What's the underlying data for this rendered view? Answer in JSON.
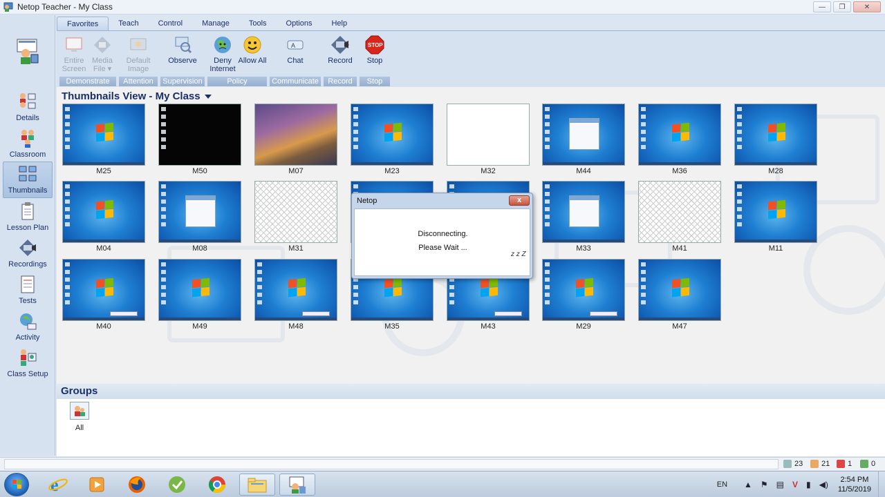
{
  "window": {
    "title": "Netop Teacher - My Class",
    "min": "—",
    "max": "❐",
    "close": "✕"
  },
  "menu": {
    "tabs": [
      "Favorites",
      "Teach",
      "Control",
      "Manage",
      "Tools",
      "Options",
      "Help"
    ],
    "active": "Favorites"
  },
  "ribbon": {
    "demonstrate": {
      "label": "Demonstrate",
      "entire_screen": "Entire Screen",
      "media_file": "Media File ▾"
    },
    "attention": {
      "label": "Attention",
      "default_image": "Default Image"
    },
    "supervision": {
      "label": "Supervision",
      "observe": "Observe"
    },
    "policy": {
      "label": "Policy",
      "deny_internet": "Deny Internet",
      "allow_all": "Allow All"
    },
    "communicate": {
      "label": "Communicate",
      "chat": "Chat"
    },
    "record": {
      "label": "Record",
      "record": "Record"
    },
    "stop": {
      "label": "Stop",
      "stop": "Stop",
      "stop_icon_text": "STOP"
    }
  },
  "sidebar": {
    "items": [
      {
        "label": "Details",
        "icon": "details-icon"
      },
      {
        "label": "Classroom",
        "icon": "classroom-icon"
      },
      {
        "label": "Thumbnails",
        "icon": "thumbnails-icon"
      },
      {
        "label": "Lesson Plan",
        "icon": "lesson-plan-icon"
      },
      {
        "label": "Recordings",
        "icon": "recordings-icon"
      },
      {
        "label": "Tests",
        "icon": "tests-icon"
      },
      {
        "label": "Activity",
        "icon": "activity-icon"
      },
      {
        "label": "Class Setup",
        "icon": "class-setup-icon"
      }
    ],
    "active": "Thumbnails"
  },
  "view": {
    "title": "Thumbnails View - My Class"
  },
  "thumbnails": [
    {
      "label": "M25",
      "screen": "win"
    },
    {
      "label": "M50",
      "screen": "black"
    },
    {
      "label": "M07",
      "screen": "photo"
    },
    {
      "label": "M23",
      "screen": "win"
    },
    {
      "label": "M32",
      "screen": "white"
    },
    {
      "label": "M44",
      "screen": "win-popup"
    },
    {
      "label": "M36",
      "screen": "win"
    },
    {
      "label": "M28",
      "screen": "win"
    },
    {
      "label": "M04",
      "screen": "win"
    },
    {
      "label": "M08",
      "screen": "win-popup"
    },
    {
      "label": "M31",
      "screen": "empty"
    },
    {
      "label": "",
      "screen": "win"
    },
    {
      "label": "",
      "screen": "win"
    },
    {
      "label": "M33",
      "screen": "win-popup"
    },
    {
      "label": "M41",
      "screen": "empty"
    },
    {
      "label": "M11",
      "screen": "win"
    },
    {
      "label": "M40",
      "screen": "win"
    },
    {
      "label": "M49",
      "screen": "win"
    },
    {
      "label": "M48",
      "screen": "win"
    },
    {
      "label": "M35",
      "screen": "win"
    },
    {
      "label": "M43",
      "screen": "win"
    },
    {
      "label": "M29",
      "screen": "win"
    },
    {
      "label": "M47",
      "screen": "win"
    }
  ],
  "dialog": {
    "title": "Netop",
    "close": "x",
    "line1": "Disconnecting.",
    "line2": "Please Wait ...",
    "zz": "z z Z"
  },
  "groups": {
    "title": "Groups",
    "items": [
      {
        "label": "All"
      }
    ]
  },
  "status": {
    "computers": "23",
    "users": "21",
    "alerts": "1",
    "zero": "0"
  },
  "taskbar": {
    "lang": "EN",
    "time": "2:54 PM",
    "date": "11/5/2019"
  }
}
